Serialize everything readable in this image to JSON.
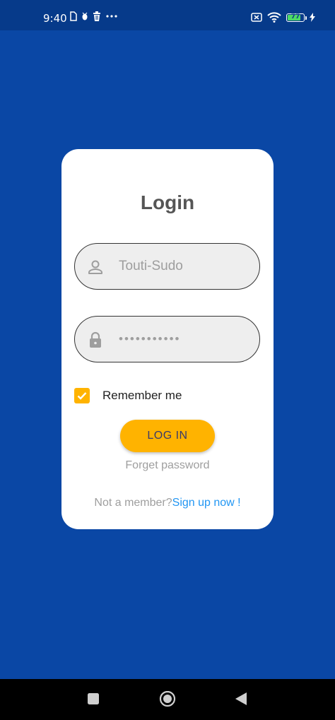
{
  "status_bar": {
    "time": "9:40",
    "battery_level": "77",
    "left_icons": [
      "sim-icon",
      "bug-icon",
      "trash-icon",
      "more-dots-icon"
    ],
    "right_icons": [
      "no-sim-icon",
      "wifi-icon",
      "battery-icon",
      "charging-icon"
    ]
  },
  "login": {
    "title": "Login",
    "username_value": "Touti-Sudo",
    "password_value": "•••••••••••",
    "remember_label": "Remember me",
    "remember_checked": true,
    "login_button": "LOG IN",
    "forget_password": "Forget password",
    "not_member": "Not a member?",
    "sign_up": "Sign up now !"
  },
  "colors": {
    "background": "#0a47a5",
    "status_bar": "#063a8a",
    "accent": "#ffb300",
    "link": "#2196f3"
  }
}
